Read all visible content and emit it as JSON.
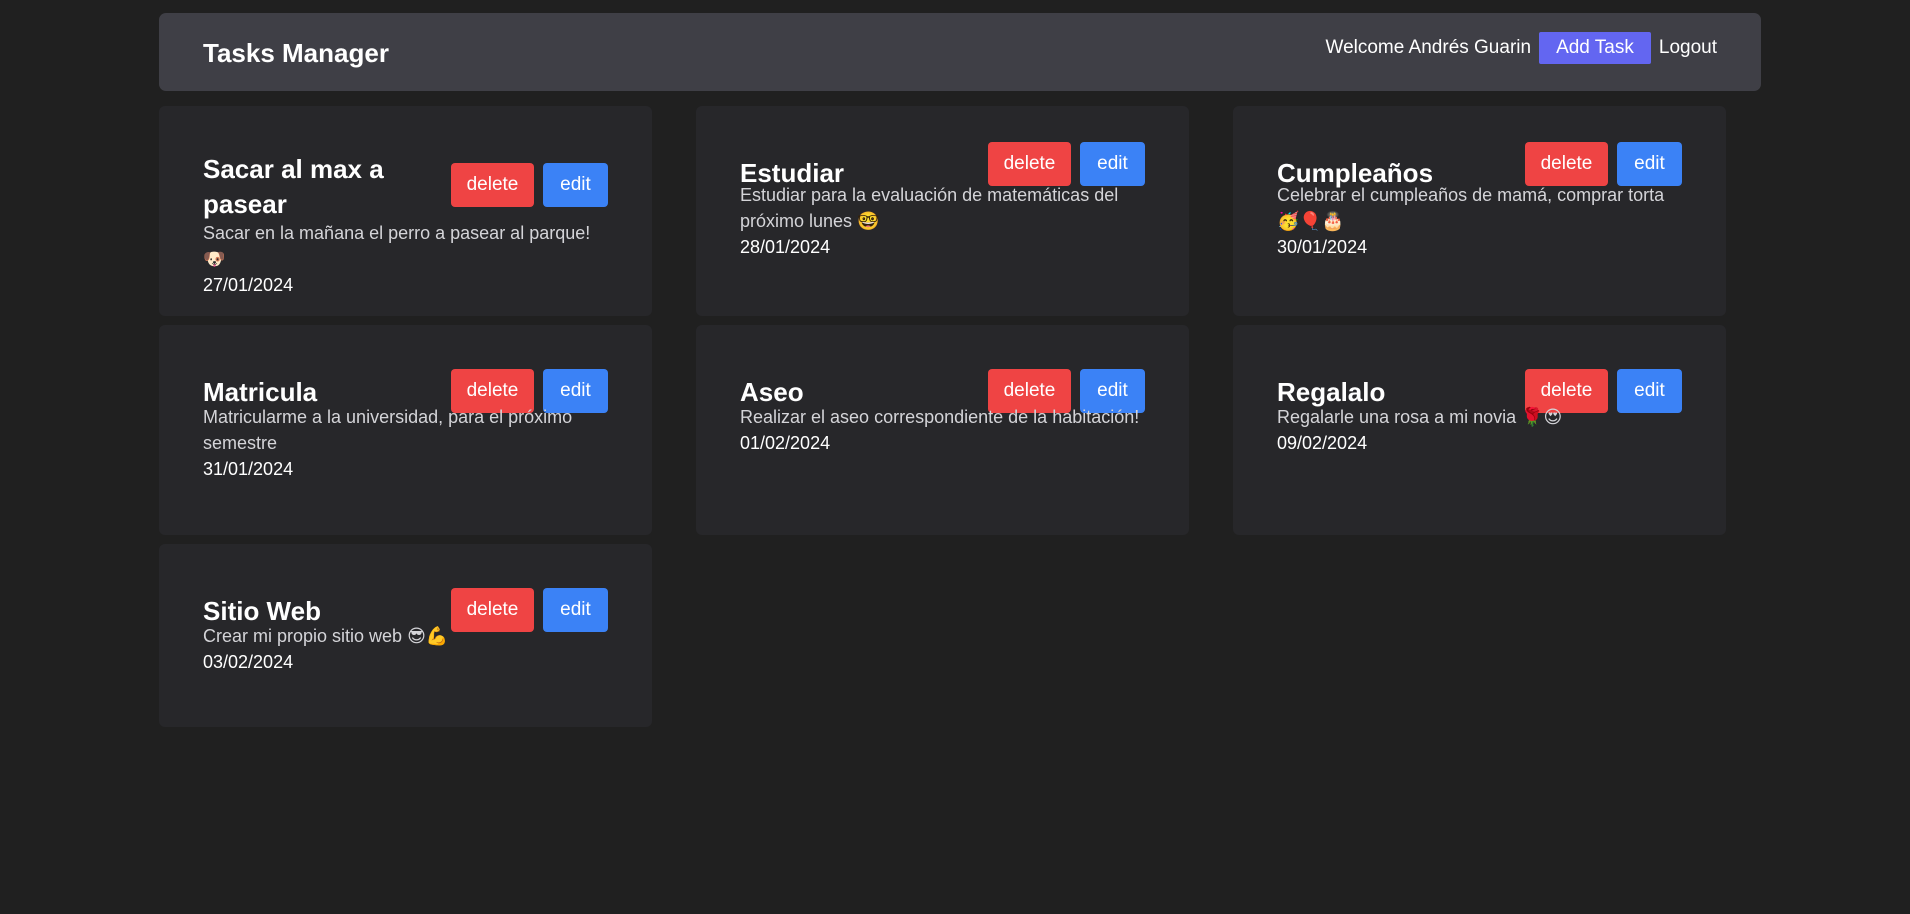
{
  "navbar": {
    "brand": "Tasks Manager",
    "welcome": "Welcome Andrés Guarin",
    "add_task_label": "Add Task",
    "logout_label": "Logout"
  },
  "colors": {
    "background": "#202020",
    "navbar": "#3f3f46",
    "card": "#27272a",
    "add_task": "#6366f1",
    "delete": "#ef4444",
    "edit": "#3b82f6"
  },
  "tasks": [
    {
      "title": "Sacar al max a pasear",
      "description": "Sacar en la mañana el perro a pasear al parque!🐶",
      "date": "27/01/2024",
      "delete_label": "delete",
      "edit_label": "edit"
    },
    {
      "title": "Estudiar",
      "description": "Estudiar para la evaluación de matemáticas del próximo lunes 🤓",
      "date": "28/01/2024",
      "delete_label": "delete",
      "edit_label": "edit"
    },
    {
      "title": "Cumpleaños",
      "description": "Celebrar el cumpleaños de mamá, comprar torta 🥳🎈🎂",
      "date": "30/01/2024",
      "delete_label": "delete",
      "edit_label": "edit"
    },
    {
      "title": "Matricula",
      "description": "Matricularme a la universidad, para el próximo semestre",
      "date": "31/01/2024",
      "delete_label": "delete",
      "edit_label": "edit"
    },
    {
      "title": "Aseo",
      "description": "Realizar el aseo correspondiente de la habitación!",
      "date": "01/02/2024",
      "delete_label": "delete",
      "edit_label": "edit"
    },
    {
      "title": "Regalalo",
      "description": "Regalarle una rosa a mi novia 🌹😍",
      "date": "09/02/2024",
      "delete_label": "delete",
      "edit_label": "edit"
    },
    {
      "title": "Sitio Web",
      "description": "Crear mi propio sitio web 😎💪",
      "date": "03/02/2024",
      "delete_label": "delete",
      "edit_label": "edit"
    }
  ]
}
